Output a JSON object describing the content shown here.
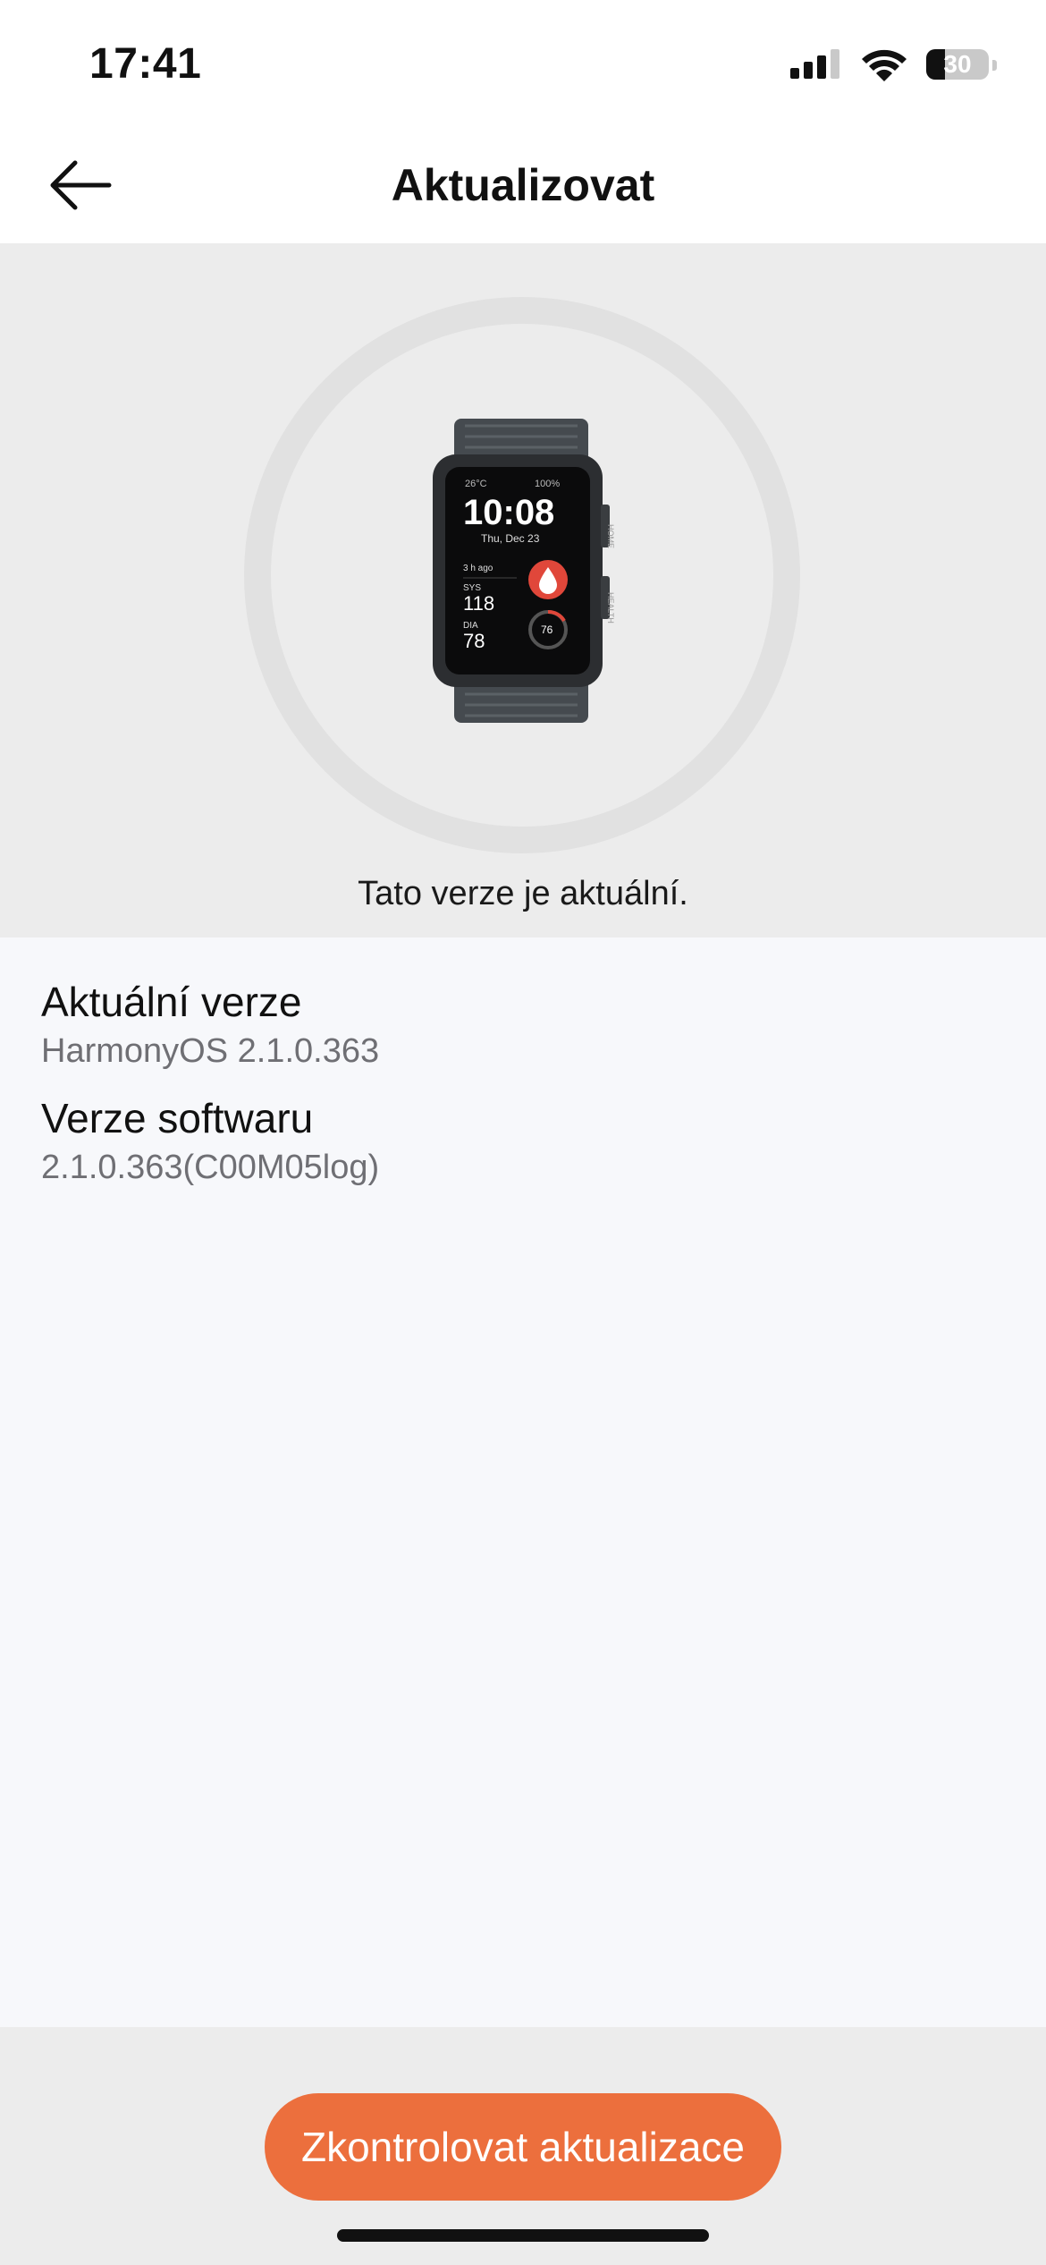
{
  "status_bar": {
    "time": "17:41",
    "battery_level": "30",
    "battery_fraction": 0.3,
    "signal_bars_active": 3,
    "signal_bars_total": 4
  },
  "nav": {
    "title": "Aktualizovat",
    "back_icon": "arrow-left-icon"
  },
  "device": {
    "image_icon": "smartwatch-image",
    "status_message": "Tato verze je aktuální.",
    "watch_screen": {
      "temperature": "26°C",
      "battery": "100%",
      "time": "10:08",
      "date": "Thu, Dec 23",
      "ago": "3 h ago",
      "sys_label": "SYS",
      "sys_value": "118",
      "dia_label": "DIA",
      "dia_value": "78",
      "pulse": "76",
      "side_labels": [
        "HOME",
        "HEALTH"
      ]
    }
  },
  "info": [
    {
      "label": "Aktuální verze",
      "value": "HarmonyOS 2.1.0.363"
    },
    {
      "label": "Verze softwaru",
      "value": "2.1.0.363(C00M05log)"
    }
  ],
  "footer": {
    "check_button_label": "Zkontrolovat aktualizace"
  },
  "colors": {
    "accent": "#ec6f3d",
    "hero_background": "#ececec",
    "page_background": "#f7f8fb"
  }
}
